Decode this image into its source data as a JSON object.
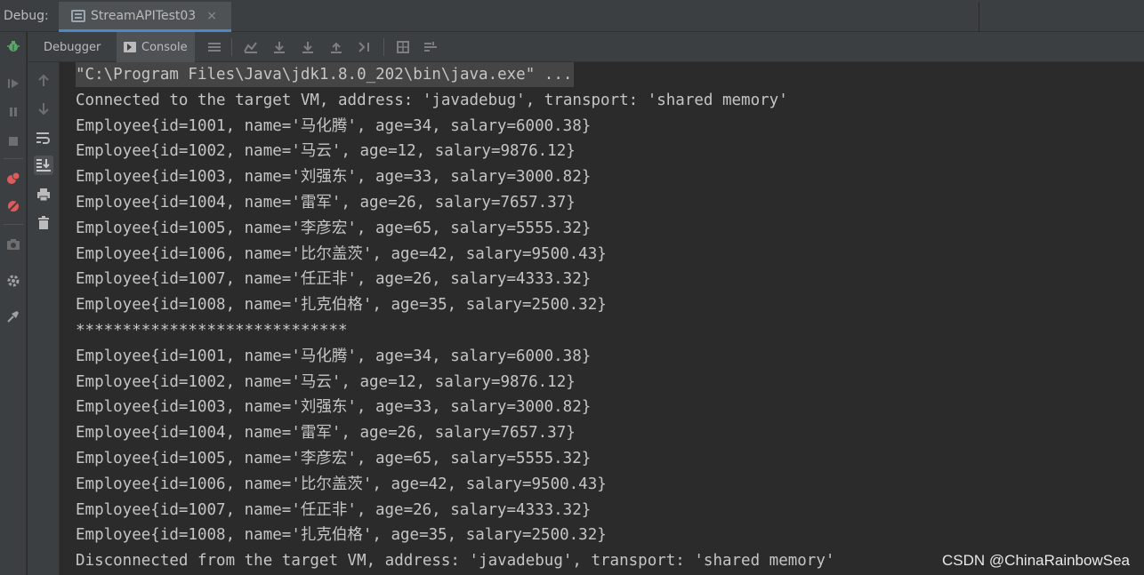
{
  "title_bar": {
    "label": "Debug:",
    "tab_label": "StreamAPITest03",
    "tab_close": "×"
  },
  "toolbar": {
    "debugger_tab": "Debugger",
    "console_tab": "Console"
  },
  "left_bar": {
    "icons": [
      "bug-icon",
      "resume-icon",
      "pause-icon",
      "stop-icon",
      "view-breakpoints-icon",
      "mute-breakpoints-icon",
      "camera-icon",
      "settings-icon",
      "pin-icon"
    ]
  },
  "console": {
    "lines": [
      "\"C:\\Program Files\\Java\\jdk1.8.0_202\\bin\\java.exe\" ...",
      "Connected to the target VM, address: 'javadebug', transport: 'shared memory'",
      "Employee{id=1001, name='马化腾', age=34, salary=6000.38}",
      "Employee{id=1002, name='马云', age=12, salary=9876.12}",
      "Employee{id=1003, name='刘强东', age=33, salary=3000.82}",
      "Employee{id=1004, name='雷军', age=26, salary=7657.37}",
      "Employee{id=1005, name='李彦宏', age=65, salary=5555.32}",
      "Employee{id=1006, name='比尔盖茨', age=42, salary=9500.43}",
      "Employee{id=1007, name='任正非', age=26, salary=4333.32}",
      "Employee{id=1008, name='扎克伯格', age=35, salary=2500.32}",
      "*****************************",
      "Employee{id=1001, name='马化腾', age=34, salary=6000.38}",
      "Employee{id=1002, name='马云', age=12, salary=9876.12}",
      "Employee{id=1003, name='刘强东', age=33, salary=3000.82}",
      "Employee{id=1004, name='雷军', age=26, salary=7657.37}",
      "Employee{id=1005, name='李彦宏', age=65, salary=5555.32}",
      "Employee{id=1006, name='比尔盖茨', age=42, salary=9500.43}",
      "Employee{id=1007, name='任正非', age=26, salary=4333.32}",
      "Employee{id=1008, name='扎克伯格', age=35, salary=2500.32}",
      "Disconnected from the target VM, address: 'javadebug', transport: 'shared memory'"
    ]
  },
  "watermark": "CSDN @ChinaRainbowSea",
  "colors": {
    "background": "#2b2b2b",
    "panel": "#3c3f41",
    "active_tab_underline": "#4a88c7",
    "bug_green": "#59a869",
    "breakpoint_red": "#db5c5c"
  }
}
